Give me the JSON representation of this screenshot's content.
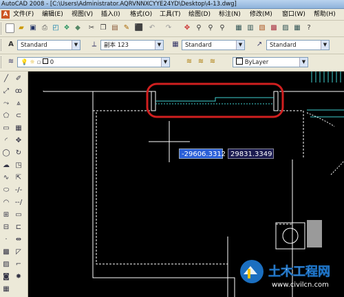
{
  "title": "AutoCAD 2008 - [C:\\Users\\Administrator.AQRVNNXCYYE24YD\\Desktop\\4-13.dwg]",
  "menu": [
    "文件(F)",
    "编辑(E)",
    "视图(V)",
    "插入(I)",
    "格式(O)",
    "工具(T)",
    "绘图(D)",
    "标注(N)",
    "修改(M)",
    "窗口(W)",
    "帮助(H)"
  ],
  "styles_toolbar": {
    "text_style": "Standard",
    "dim_style": "副本 123",
    "table_style": "Standard",
    "multileader_style": "Standard"
  },
  "layers_toolbar": {
    "layer": "0",
    "color": "ByLayer"
  },
  "coordinates": {
    "x": "-29606.3312",
    "y": "29831.3349"
  },
  "watermark": {
    "text": "土木工程网",
    "url": "www.civilcn.com"
  },
  "colors": {
    "canvas": "#000000",
    "highlight_ellipse": "#d01f1f",
    "cyan_lines": "#3fd2d2",
    "accent": "#2a5fd8"
  }
}
